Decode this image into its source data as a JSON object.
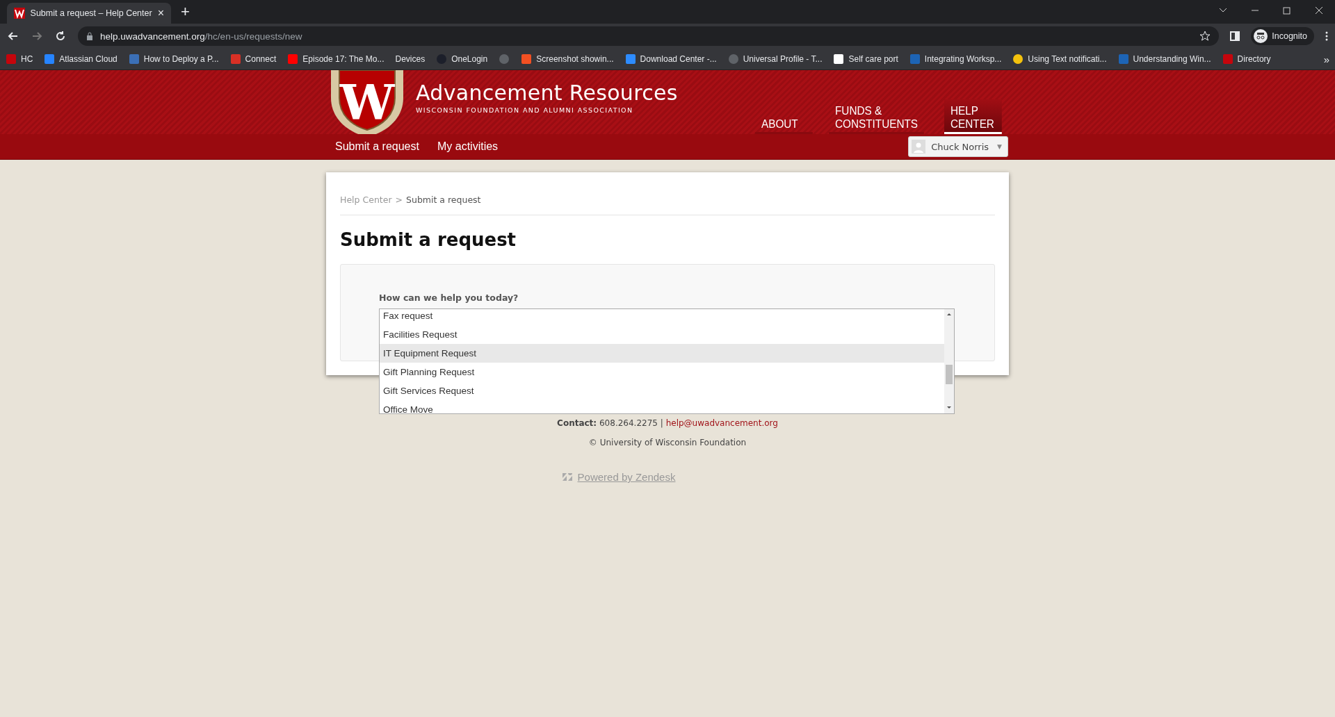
{
  "browser": {
    "tab": {
      "title": "Submit a request – Help Center",
      "close": "×"
    },
    "new_tab": "+",
    "url": {
      "host": "help.uwadvancement.org",
      "path": "/hc/en-us/requests/new"
    },
    "profile": "Incognito",
    "bookmarks": [
      {
        "label": "HC",
        "kind": "w"
      },
      {
        "label": "Atlassian Cloud",
        "kind": "atlassian"
      },
      {
        "label": "How to Deploy a P...",
        "kind": "bp"
      },
      {
        "label": "Connect",
        "kind": "calendar"
      },
      {
        "label": "Episode 17: The Mo...",
        "kind": "youtube"
      },
      {
        "label": "Devices",
        "kind": "blank"
      },
      {
        "label": "OneLogin",
        "kind": "onelogin"
      },
      {
        "kind": "globe"
      },
      {
        "label": "Screenshot showin...",
        "kind": "ms"
      },
      {
        "label": "Download Center -...",
        "kind": "zoom"
      },
      {
        "label": "Universal Profile - T...",
        "kind": "globe"
      },
      {
        "label": "Self care port",
        "kind": "cisco"
      },
      {
        "label": "Integrating Worksp...",
        "kind": "vmw"
      },
      {
        "label": "Using Text notificati...",
        "kind": "dot"
      },
      {
        "label": "Understanding Win...",
        "kind": "vmw"
      },
      {
        "label": "Directory",
        "kind": "w"
      }
    ],
    "more": "»"
  },
  "site": {
    "logo_letter": "W",
    "title": "Advancement Resources",
    "subtitle": "WISCONSIN FOUNDATION AND ALUMNI ASSOCIATION",
    "nav": [
      {
        "lines": [
          "ABOUT"
        ],
        "selected": false
      },
      {
        "lines": [
          "FUNDS &",
          "CONSTITUENTS"
        ],
        "selected": false
      },
      {
        "lines": [
          "HELP",
          "CENTER"
        ],
        "selected": true
      }
    ],
    "subnav": [
      "Submit a request",
      "My activities"
    ],
    "user": "Chuck Norris",
    "user_caret": "▼"
  },
  "breadcrumb": {
    "parent": "Help Center",
    "separator": ">",
    "current": "Submit a request"
  },
  "heading": "Submit a request",
  "form": {
    "label": "How can we help you today?",
    "options": [
      {
        "label": "Fax request",
        "selected": false
      },
      {
        "label": "Facilities Request",
        "selected": false
      },
      {
        "label": "IT Equipment Request",
        "selected": true
      },
      {
        "label": "Gift Planning Request",
        "selected": false
      },
      {
        "label": "Gift Services Request",
        "selected": false
      },
      {
        "label": "Office Move",
        "selected": false
      }
    ]
  },
  "footer": {
    "contact_label": "Contact:",
    "phone": "608.264.2275",
    "divider": "|",
    "email": "help@uwadvancement.org",
    "copyright": "© University of Wisconsin Foundation",
    "powered": "Powered by Zendesk"
  }
}
